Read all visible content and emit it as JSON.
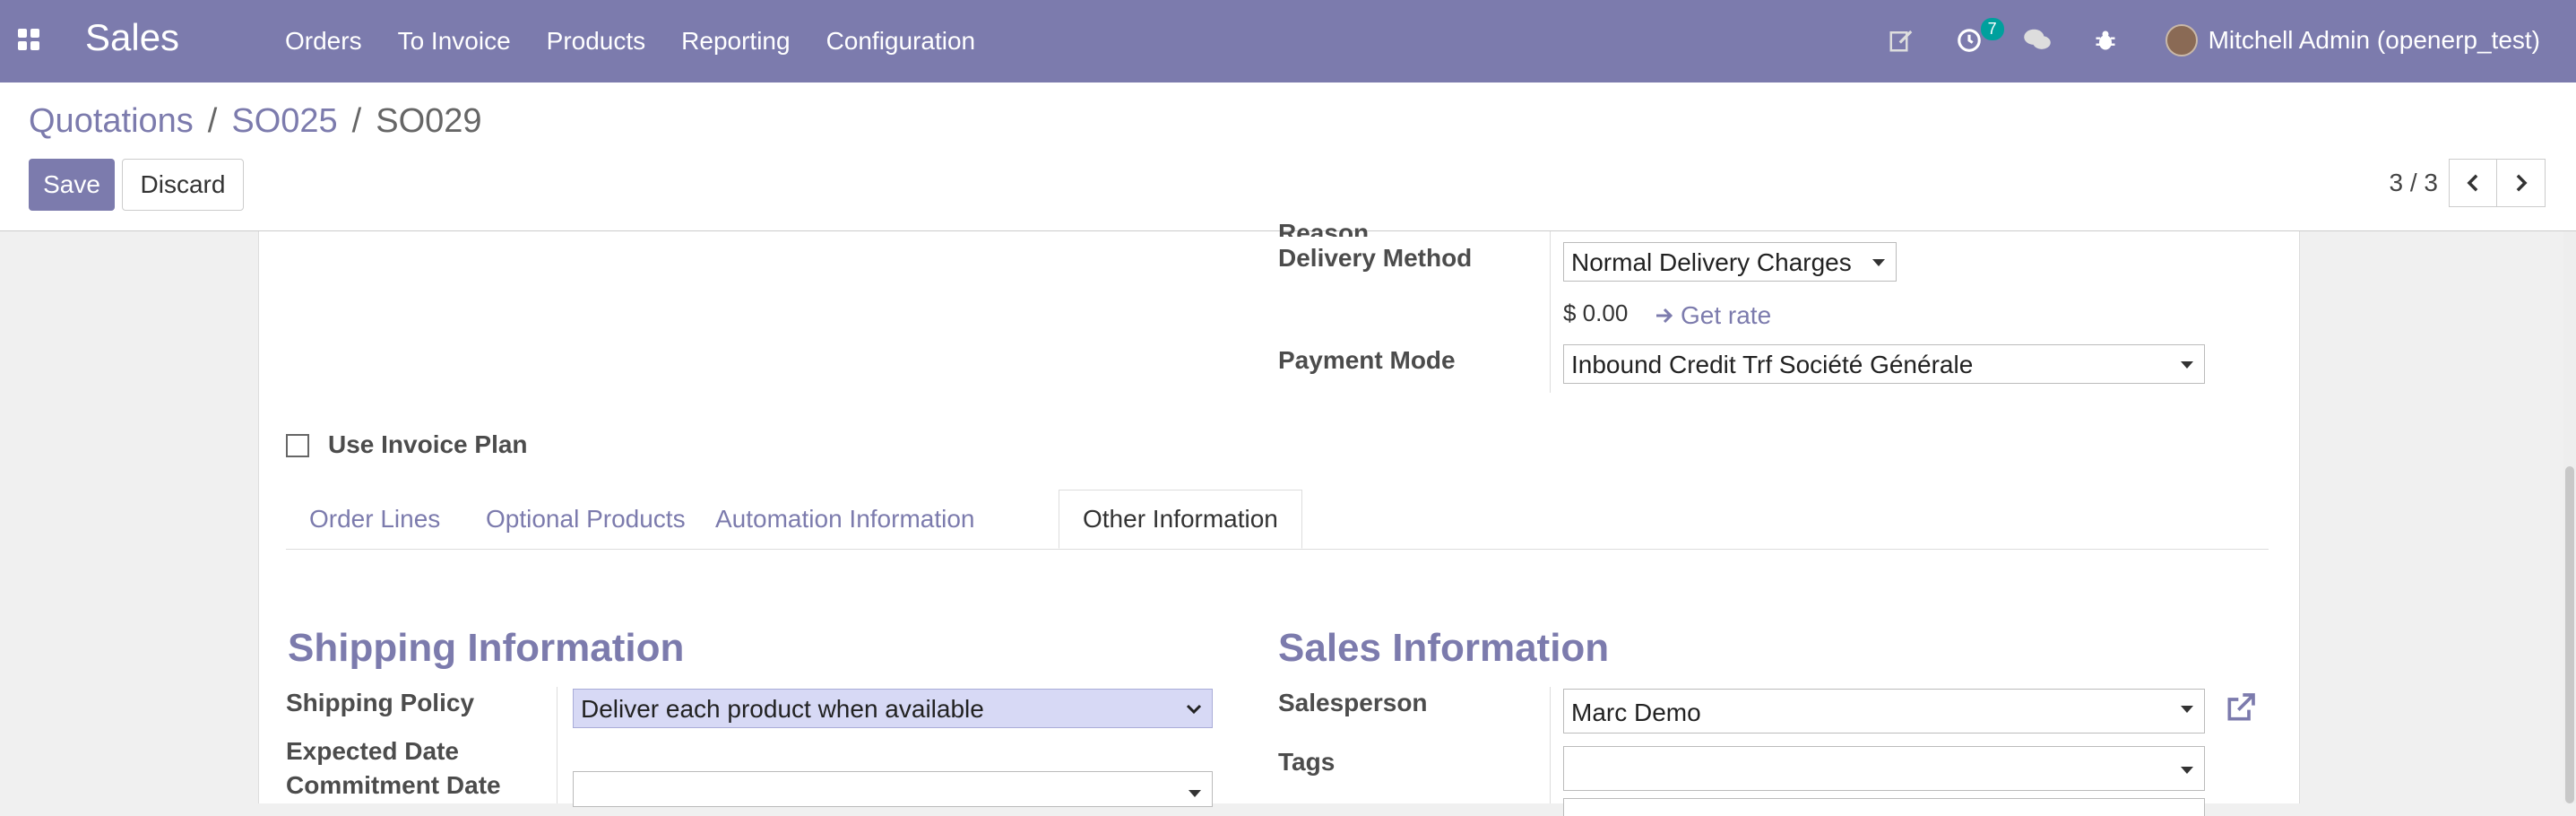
{
  "app": {
    "name": "Sales",
    "menu": [
      "Orders",
      "To Invoice",
      "Products",
      "Reporting",
      "Configuration"
    ],
    "activity_count": "7",
    "user": "Mitchell Admin (openerp_test)",
    "accent_color": "#7c7bad"
  },
  "breadcrumb": [
    "Quotations",
    "SO025",
    "SO029"
  ],
  "buttons": {
    "save": "Save",
    "discard": "Discard"
  },
  "pager": {
    "value": "3 / 3"
  },
  "form": {
    "reason_label_partial": "Reason",
    "delivery_method_label": "Delivery Method",
    "delivery_method_value": "Normal Delivery Charges",
    "delivery_price": "$ 0.00",
    "get_rate": "Get rate",
    "payment_mode_label": "Payment Mode",
    "payment_mode_value": "Inbound Credit Trf Société Générale",
    "invoice_plan_label": "Use Invoice Plan"
  },
  "tabs": [
    {
      "label": "Order Lines",
      "active": false
    },
    {
      "label": "Optional Products",
      "active": false
    },
    {
      "label": "Automation Information",
      "active": false
    },
    {
      "label": "Other Information",
      "active": true
    }
  ],
  "shipping": {
    "title": "Shipping Information",
    "policy_label": "Shipping Policy",
    "policy_value": "Deliver each product when available",
    "expected_date_label": "Expected Date",
    "commitment_date_label": "Commitment Date"
  },
  "sales_info": {
    "title": "Sales Information",
    "salesperson_label": "Salesperson",
    "salesperson_value": "Marc Demo",
    "tags_label": "Tags"
  }
}
